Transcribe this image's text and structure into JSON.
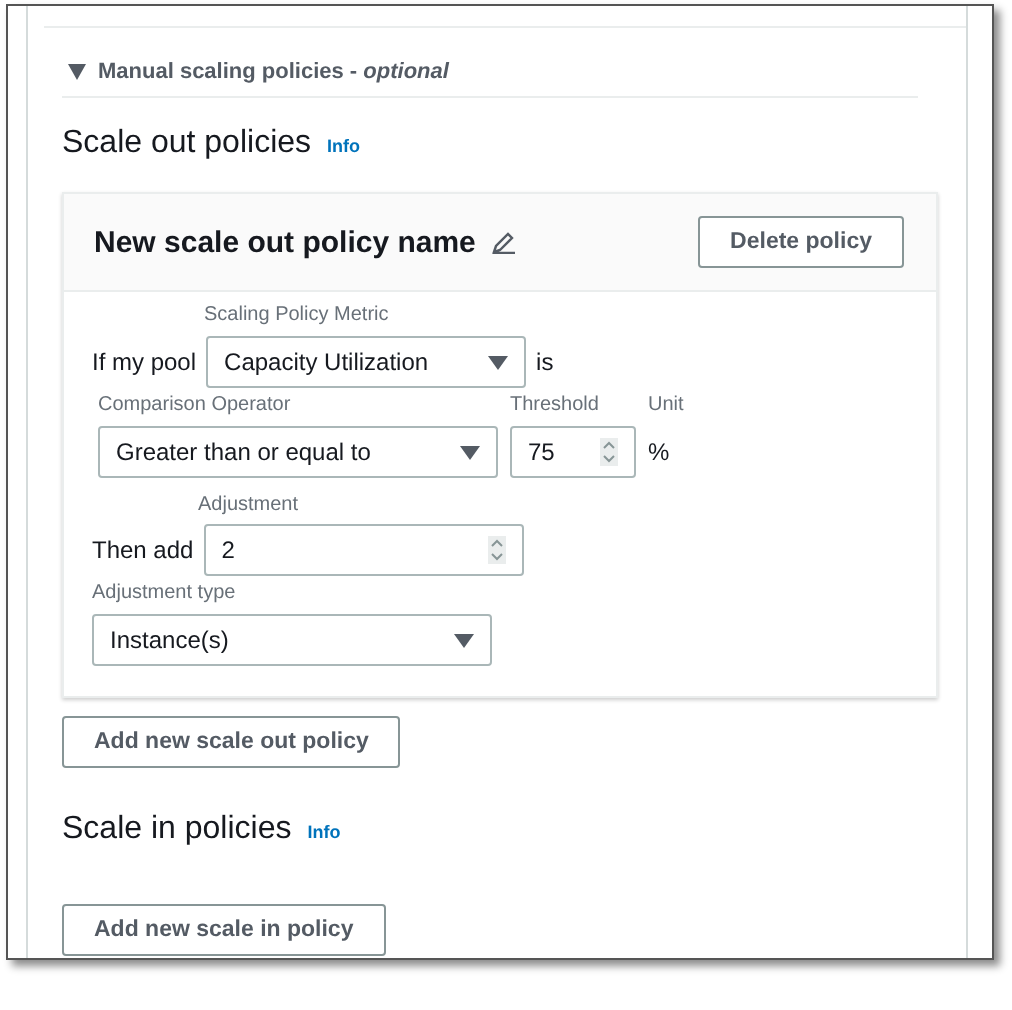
{
  "section": {
    "title": "Manual scaling policies - *optional*",
    "expanded": true
  },
  "scale_out": {
    "heading": "Scale out policies",
    "info": "Info",
    "policies": [
      {
        "name": "New scale out policy name",
        "delete_button": "Delete policy",
        "if_label": "If my pool",
        "metric_label": "Scaling Policy Metric",
        "metric_value": "Capacity Utilization",
        "is_label": "is",
        "operator_label": "Comparison Operator",
        "operator_value": "Greater than or equal to",
        "threshold_label": "Threshold",
        "threshold_value": "75",
        "unit_label": "Unit",
        "unit_value": "%",
        "then_label": "Then add",
        "adjustment_label": "Adjustment",
        "adjustment_value": "2",
        "type_label": "Adjustment type",
        "type_value": "Instance(s)"
      }
    ],
    "add_button": "Add new scale out policy"
  },
  "scale_in": {
    "heading": "Scale in policies",
    "info": "Info",
    "add_button": "Add new scale in policy"
  }
}
